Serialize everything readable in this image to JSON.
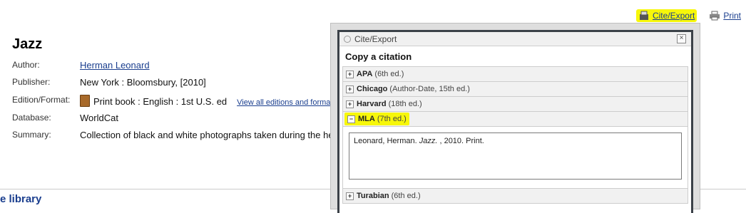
{
  "toolbar": {
    "cite_export": "Cite/Export",
    "print": "Print"
  },
  "record": {
    "title": "Jazz",
    "fields": [
      {
        "label": "Author:",
        "value": "Herman Leonard"
      },
      {
        "label": "Publisher:",
        "value": "New York : Bloomsbury, [2010]"
      },
      {
        "label": "Edition/Format:",
        "value": "Print book : English : 1st U.S. ed",
        "extra_link": "View all editions and formats"
      },
      {
        "label": "Database:",
        "value": "WorldCat"
      },
      {
        "label": "Summary:",
        "value": "Collection of black and white photographs taken during the hei"
      }
    ]
  },
  "footer": {
    "library": "e library"
  },
  "modal": {
    "header": "Cite/Export",
    "close": "×",
    "heading": "Copy a citation",
    "styles": [
      {
        "name": "APA",
        "edition": "(6th ed.)"
      },
      {
        "name": "Chicago",
        "edition": "(Author-Date, 15th ed.)"
      },
      {
        "name": "Harvard",
        "edition": "(18th ed.)"
      },
      {
        "name": "MLA",
        "edition": "(7th ed.)"
      },
      {
        "name": "Turabian",
        "edition": "(6th ed.)"
      }
    ],
    "citation": {
      "before": "Leonard, Herman. ",
      "italic": "Jazz.",
      "after": " , 2010. Print."
    },
    "highlight_color": "#f7f70a"
  }
}
